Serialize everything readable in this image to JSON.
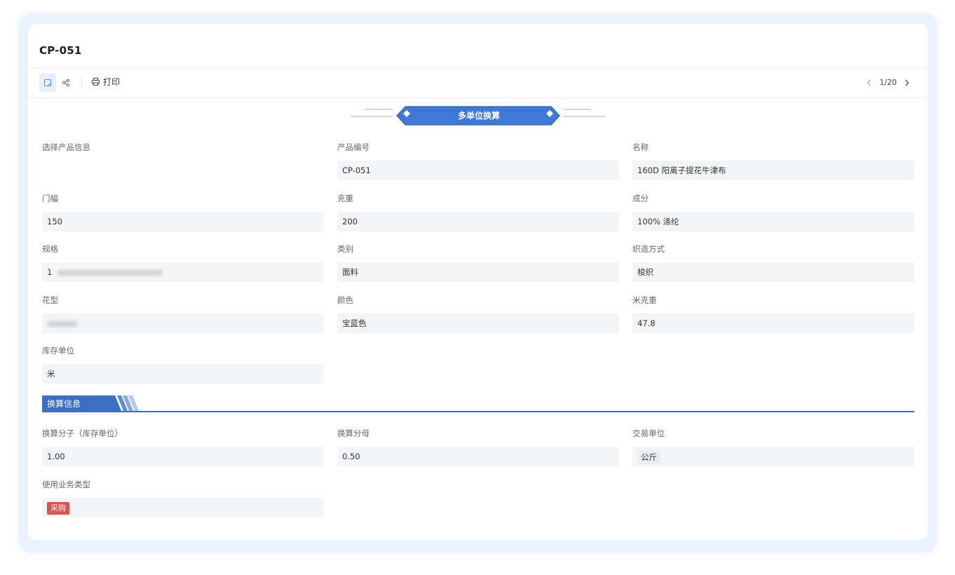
{
  "page": {
    "title": "CP-051"
  },
  "toolbar": {
    "print_label": "打印"
  },
  "pager": {
    "text": "1/20"
  },
  "banner": {
    "title": "多单位换算"
  },
  "fields": {
    "select_product": {
      "label": "选择产品信息"
    },
    "product_code": {
      "label": "产品编号",
      "value": "CP-051"
    },
    "name": {
      "label": "名称",
      "value": "160D 阳离子提花牛津布"
    },
    "width": {
      "label": "门幅",
      "value": "150"
    },
    "gram_weight": {
      "label": "克重",
      "value": "200"
    },
    "composition": {
      "label": "成分",
      "value": "100% 涤纶"
    },
    "spec": {
      "label": "规格",
      "value": "1"
    },
    "category": {
      "label": "类别",
      "value": "面料"
    },
    "weave": {
      "label": "织造方式",
      "value": "梭织"
    },
    "pattern": {
      "label": "花型"
    },
    "color": {
      "label": "颜色",
      "value": "宝蓝色"
    },
    "meter_weight": {
      "label": "米克重",
      "value": "47.8"
    },
    "stock_unit": {
      "label": "库存单位",
      "value": "米"
    }
  },
  "section": {
    "title": "换算信息"
  },
  "conversion": {
    "numerator": {
      "label": "换算分子（库存单位）",
      "value": "1.00"
    },
    "denominator": {
      "label": "换算分母",
      "value": "0.50"
    },
    "trade_unit": {
      "label": "交易单位",
      "value": "公斤"
    },
    "business_type": {
      "label": "使用业务类型",
      "tag": "采购"
    }
  },
  "colors": {
    "accent": "#3a6fc4",
    "tag_red": "#d9534f",
    "banner_blue": "#3f79d8"
  }
}
